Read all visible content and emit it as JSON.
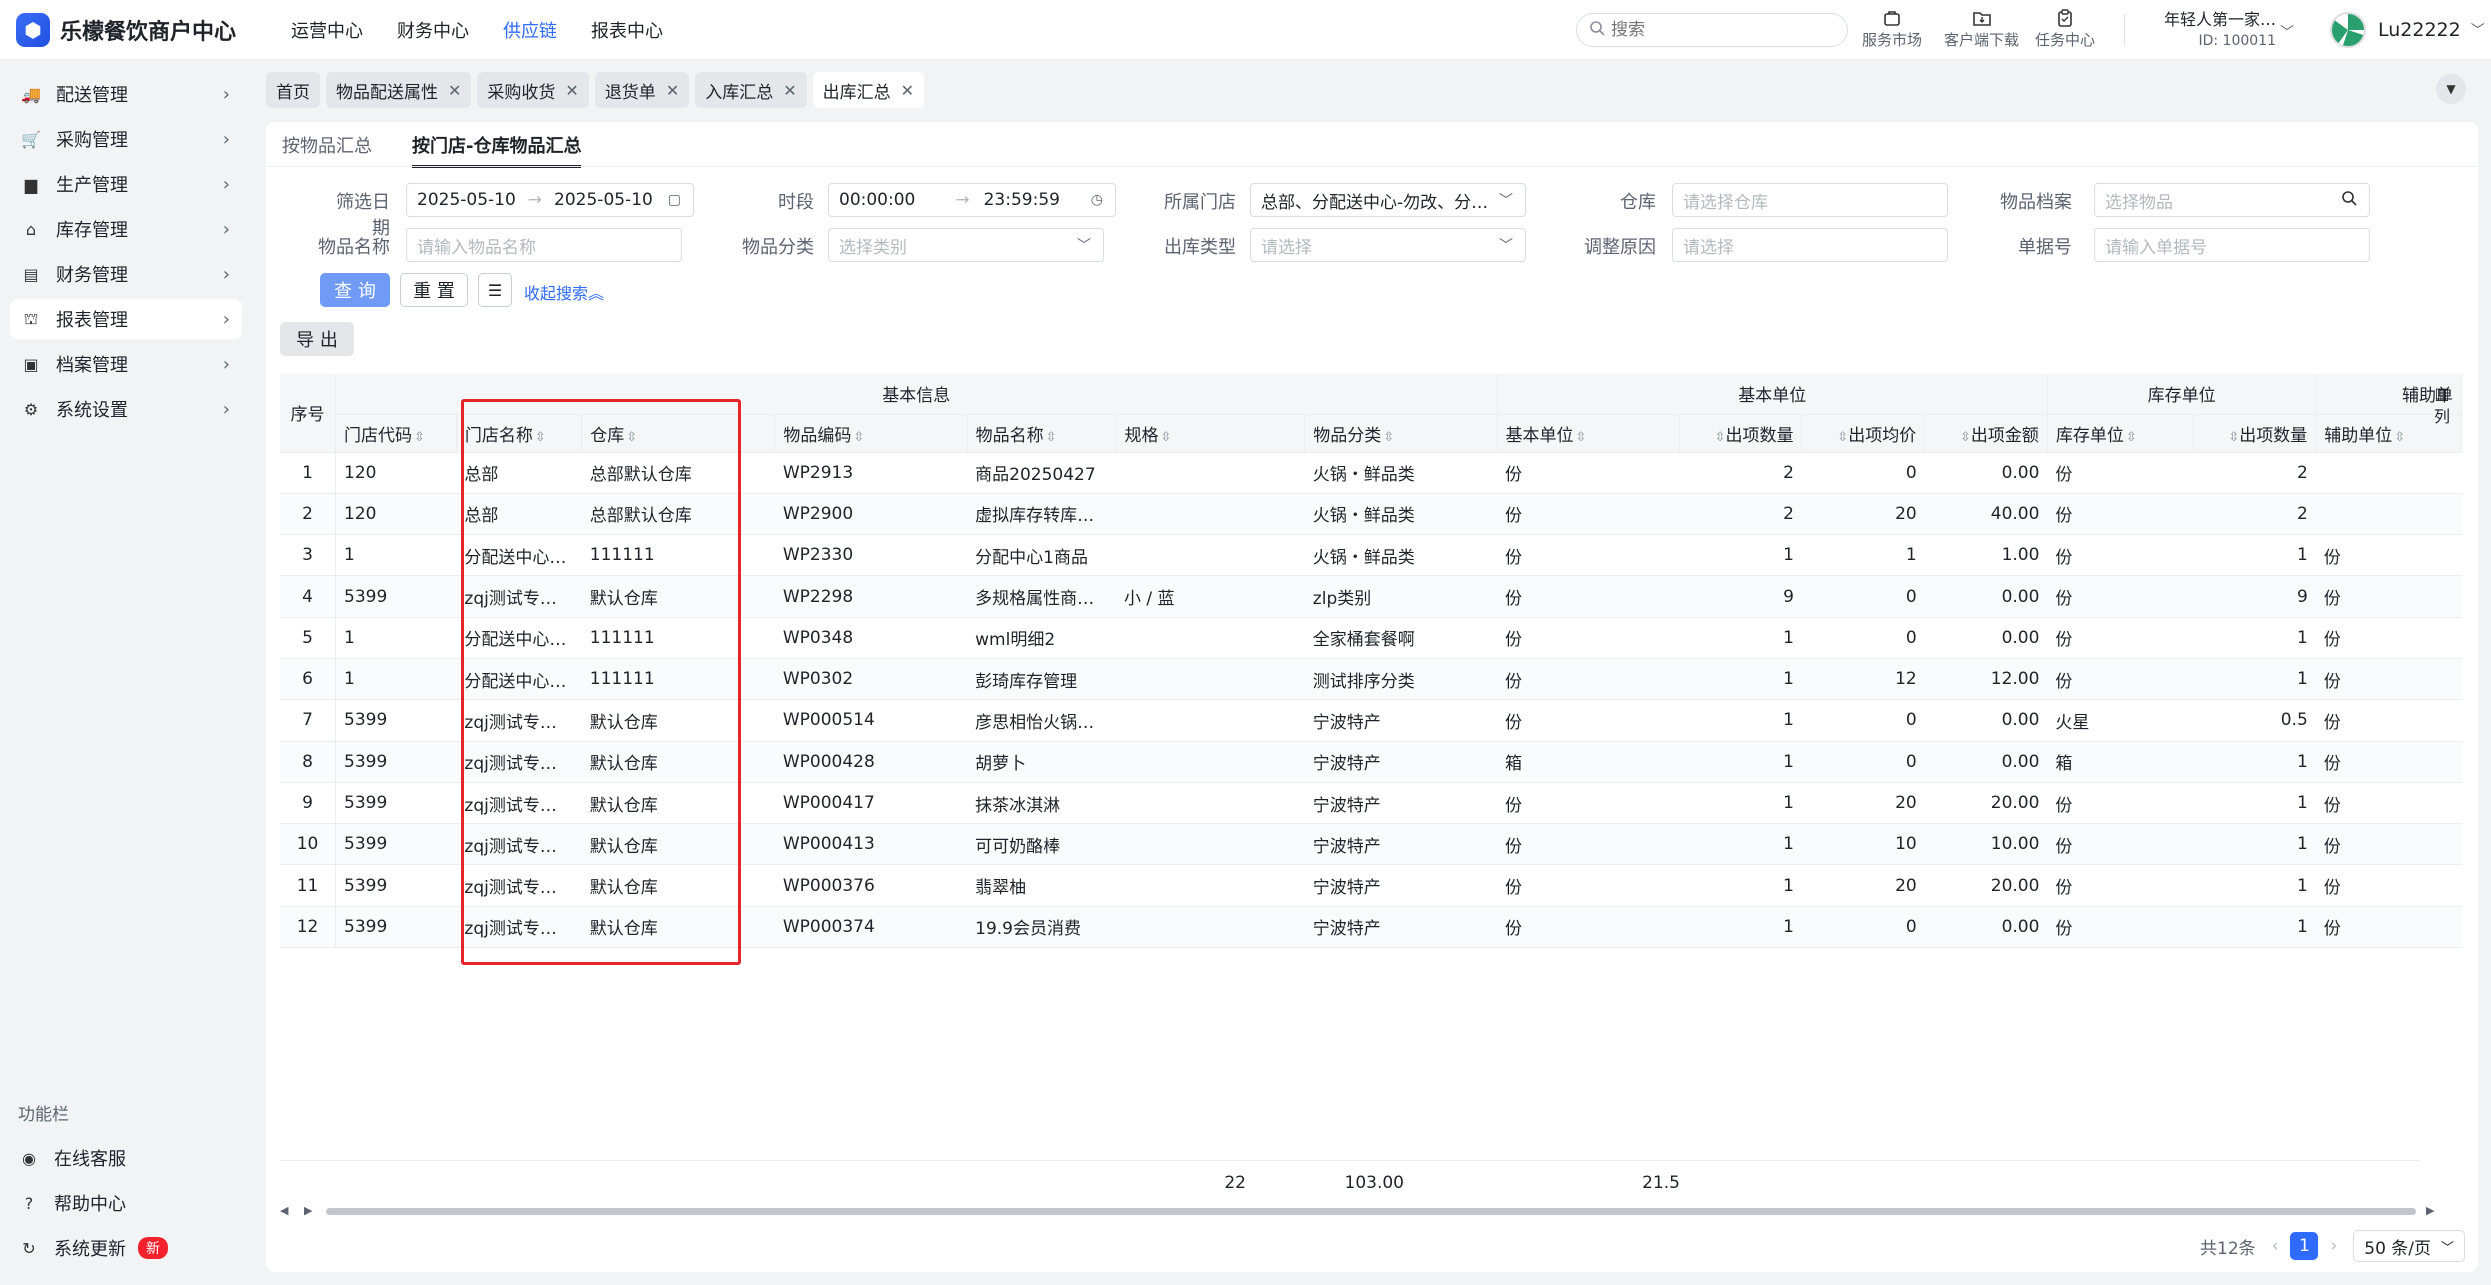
{
  "app": {
    "logo_glyph": "⬢",
    "title": "乐檬餐饮商户中心"
  },
  "topnav": [
    "运营中心",
    "财务中心",
    "供应链",
    "报表中心"
  ],
  "topnav_active": 2,
  "search": {
    "placeholder": "搜索"
  },
  "top_icons": [
    {
      "name": "service-market",
      "label": "服务市场"
    },
    {
      "name": "client-download",
      "label": "客户端下载"
    },
    {
      "name": "task-center",
      "label": "任务中心"
    }
  ],
  "merchant": {
    "name": "年轻人第一家…",
    "id": "ID: 100011"
  },
  "user": {
    "name": "Lu22222"
  },
  "sidebar": {
    "items": [
      {
        "label": "配送管理",
        "icon": "truck-icon",
        "glyph": "🚚"
      },
      {
        "label": "采购管理",
        "icon": "cart-icon",
        "glyph": "🛒"
      },
      {
        "label": "生产管理",
        "icon": "chart-icon",
        "glyph": "▆"
      },
      {
        "label": "库存管理",
        "icon": "warehouse-icon",
        "glyph": "⌂"
      },
      {
        "label": "财务管理",
        "icon": "ledger-icon",
        "glyph": "▤"
      },
      {
        "label": "报表管理",
        "icon": "store-icon",
        "glyph": "⛫"
      },
      {
        "label": "档案管理",
        "icon": "archive-icon",
        "glyph": "▣"
      },
      {
        "label": "系统设置",
        "icon": "gear-icon",
        "glyph": "⚙"
      }
    ],
    "active": 5,
    "function_title": "功能栏",
    "functions": [
      {
        "label": "在线客服",
        "icon": "headset-icon",
        "glyph": "◉"
      },
      {
        "label": "帮助中心",
        "icon": "help-icon",
        "glyph": "?"
      },
      {
        "label": "系统更新",
        "icon": "refresh-icon",
        "glyph": "↻",
        "badge": "新"
      }
    ]
  },
  "page_tabs": [
    "首页",
    "物品配送属性",
    "采购收货",
    "退货单",
    "入库汇总",
    "出库汇总"
  ],
  "page_tab_active": 5,
  "subtabs": [
    "按物品汇总",
    "按门店-仓库物品汇总"
  ],
  "subtab_active": 1,
  "filters": {
    "date_label": "筛选日期",
    "date_start": "2025-05-10",
    "date_end": "2025-05-10",
    "time_label": "时段",
    "time_start": "00:00:00",
    "time_end": "23:59:59",
    "store_label": "所属门店",
    "store_value": "总部、分配送中心-勿改、分…",
    "warehouse_label": "仓库",
    "warehouse_placeholder": "请选择仓库",
    "item_file_label": "物品档案",
    "item_file_placeholder": "选择物品",
    "item_name_label": "物品名称",
    "item_name_placeholder": "请输入物品名称",
    "category_label": "物品分类",
    "category_placeholder": "选择类别",
    "out_type_label": "出库类型",
    "out_type_placeholder": "请选择",
    "reason_label": "调整原因",
    "reason_placeholder": "请选择",
    "doc_no_label": "单据号",
    "doc_no_placeholder": "请输入单据号",
    "query_btn": "查 询",
    "reset_btn": "重 置",
    "collapse_link": "收起搜索"
  },
  "export_btn": "导 出",
  "table": {
    "groups": {
      "seq": "序号",
      "basic_info": "基本信息",
      "basic_unit": "基本单位",
      "stock_unit": "库存单位",
      "aux_unit": "辅助单"
    },
    "columns": [
      "门店代码",
      "门店名称",
      "仓库",
      "物品编码",
      "物品名称",
      "规格",
      "物品分类",
      "基本单位",
      "出项数量",
      "出项均价",
      "出项金额",
      "库存单位",
      "出项数量",
      "辅助单位"
    ],
    "rows": [
      [
        "1",
        "120",
        "总部",
        "总部默认仓库",
        "WP2913",
        "商品20250427",
        "",
        "火锅・鲜品类",
        "份",
        "2",
        "0",
        "0.00",
        "份",
        "2",
        ""
      ],
      [
        "2",
        "120",
        "总部",
        "总部默认仓库",
        "WP2900",
        "虚拟库存转库…",
        "",
        "火锅・鲜品类",
        "份",
        "2",
        "20",
        "40.00",
        "份",
        "2",
        ""
      ],
      [
        "3",
        "1",
        "分配送中心…",
        "111111",
        "WP2330",
        "分配中心1商品",
        "",
        "火锅・鲜品类",
        "份",
        "1",
        "1",
        "1.00",
        "份",
        "1",
        "份"
      ],
      [
        "4",
        "5399",
        "zqj测试专…",
        "默认仓库",
        "WP2298",
        "多规格属性商…",
        "小 / 蓝",
        "zlp类别",
        "份",
        "9",
        "0",
        "0.00",
        "份",
        "9",
        "份"
      ],
      [
        "5",
        "1",
        "分配送中心…",
        "111111",
        "WP0348",
        "wml明细2",
        "",
        "全家桶套餐啊",
        "份",
        "1",
        "0",
        "0.00",
        "份",
        "1",
        "份"
      ],
      [
        "6",
        "1",
        "分配送中心…",
        "111111",
        "WP0302",
        "彭琦库存管理",
        "",
        "测试排序分类",
        "份",
        "1",
        "12",
        "12.00",
        "份",
        "1",
        "份"
      ],
      [
        "7",
        "5399",
        "zqj测试专…",
        "默认仓库",
        "WP000514",
        "彦思相怡火锅…",
        "",
        "宁波特产",
        "份",
        "1",
        "0",
        "0.00",
        "火星",
        "0.5",
        "份"
      ],
      [
        "8",
        "5399",
        "zqj测试专…",
        "默认仓库",
        "WP000428",
        "胡萝卜",
        "",
        "宁波特产",
        "箱",
        "1",
        "0",
        "0.00",
        "箱",
        "1",
        "份"
      ],
      [
        "9",
        "5399",
        "zqj测试专…",
        "默认仓库",
        "WP000417",
        "抹茶冰淇淋",
        "",
        "宁波特产",
        "份",
        "1",
        "20",
        "20.00",
        "份",
        "1",
        "份"
      ],
      [
        "10",
        "5399",
        "zqj测试专…",
        "默认仓库",
        "WP000413",
        "可可奶酪棒",
        "",
        "宁波特产",
        "份",
        "1",
        "10",
        "10.00",
        "份",
        "1",
        "份"
      ],
      [
        "11",
        "5399",
        "zqj测试专…",
        "默认仓库",
        "WP000376",
        "翡翠柚",
        "",
        "宁波特产",
        "份",
        "1",
        "20",
        "20.00",
        "份",
        "1",
        "份"
      ],
      [
        "12",
        "5399",
        "zqj测试专…",
        "默认仓库",
        "WP000374",
        "19.9会员消费",
        "",
        "宁波特产",
        "份",
        "1",
        "0",
        "0.00",
        "份",
        "1",
        "份"
      ]
    ],
    "totals": {
      "out_qty": "22",
      "out_amount": "103.00",
      "stock_out_qty": "21.5"
    },
    "col_tool": "列"
  },
  "pager": {
    "total": "共12条",
    "current": "1",
    "page_size": "50 条/页"
  }
}
